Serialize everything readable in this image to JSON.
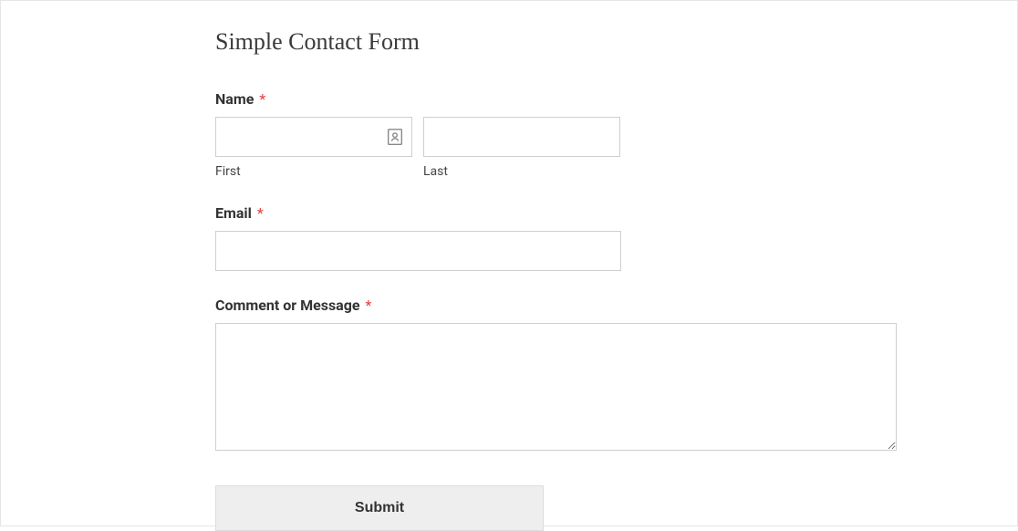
{
  "form": {
    "title": "Simple Contact Form",
    "required_mark": "*",
    "fields": {
      "name": {
        "label": "Name",
        "first_sublabel": "First",
        "last_sublabel": "Last",
        "first_value": "",
        "last_value": ""
      },
      "email": {
        "label": "Email",
        "value": ""
      },
      "message": {
        "label": "Comment or Message",
        "value": ""
      }
    },
    "submit_label": "Submit"
  }
}
